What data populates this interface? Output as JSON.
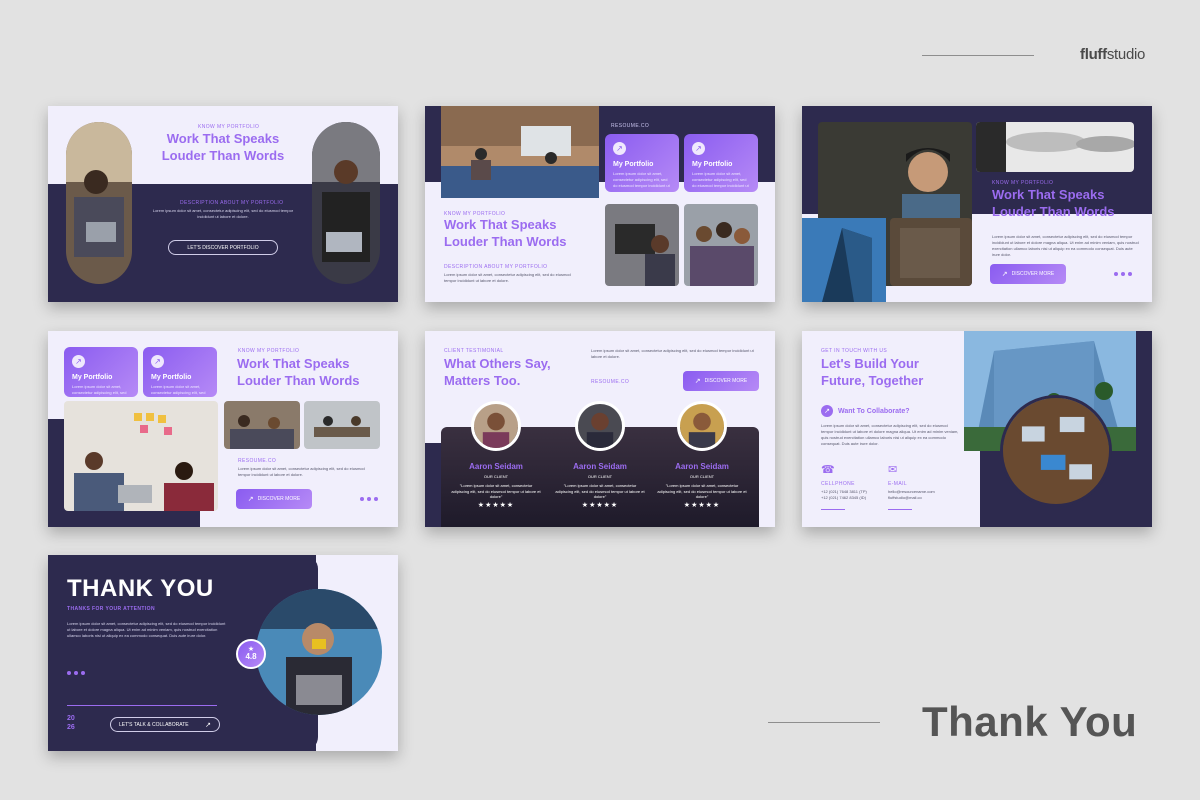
{
  "brand": {
    "bold": "fluff",
    "thin": "studio"
  },
  "footer_title": "Thank You",
  "common": {
    "kicker_portfolio": "KNOW MY PORTFOLIO",
    "headline_1": "Work That Speaks",
    "headline_2": "Louder Than Words",
    "desc_label": "DESCRIPTION ABOUT MY PORTFOLIO",
    "lorem": "Lorem ipsum dolor sit amet, consectetur adipiscing elit, sed do eiusmod tempor incididunt ut labore et dolore magna aliqua. Ut enim ad minim veniam, quis nostrud exercitation ullamco laboris nisi ut aliquip ex ea commodo consequat. Duis aute irure dolor.",
    "lorem_short": "Lorem ipsum dolor sit amet, consectetur adipiscing elit, sed do eiusmod tempor incididunt ut labore et dolore.",
    "resume": "RESOUME.CO",
    "discover_more": "DISCOVER MORE",
    "my_portfolio": "My Portfolio"
  },
  "slide1": {
    "button": "LET'S DISCOVER PORTFOLIO"
  },
  "slide5": {
    "kicker": "CLIENT TESTIMONIAL",
    "title_1": "What Others Say,",
    "title_2": "Matters Too.",
    "testimonials": [
      {
        "name": "Aaron Seidam",
        "role": "OUR CLIENT",
        "quote": "\"Lorem ipsum dolor sit amet, consectetur adipiscing elit, sed do eiusmod tempor ut labore et dolore\"",
        "stars": "★★★★★"
      },
      {
        "name": "Aaron Seidam",
        "role": "OUR CLIENT",
        "quote": "\"Lorem ipsum dolor sit amet, consectetur adipiscing elit, sed do eiusmod tempor ut labore et dolore\"",
        "stars": "★★★★★"
      },
      {
        "name": "Aaron Seidam",
        "role": "OUR CLIENT",
        "quote": "\"Lorem ipsum dolor sit amet, consectetur adipiscing elit, sed do eiusmod tempor ut labore et dolore\"",
        "stars": "★★★★★"
      }
    ]
  },
  "slide6": {
    "kicker": "GET IN TOUCH WITH US",
    "title_1": "Let's Build Your",
    "title_2": "Future, Together",
    "collab": "Want To Collaborate?",
    "phone_label": "CELLPHONE",
    "phone_1": "+12 (021) 7648 3811 (TP)",
    "phone_2": "+12 (021) 7462 8345 (ID)",
    "email_label": "E-MAIL",
    "email_1": "hello@resourcename.com",
    "email_2": "fluffstudio@mail.co"
  },
  "slide7": {
    "title": "THANK YOU",
    "subtitle": "THANKS FOR YOUR ATTENTION",
    "year_1": "20",
    "year_2": "26",
    "button": "LET'S TALK & COLLABORATE",
    "rating": "4.8"
  },
  "colors": {
    "accent": "#9b6cf0",
    "navy": "#2d2a4e",
    "background": "#e2e2e2",
    "slide_bg": "#f1effc"
  }
}
